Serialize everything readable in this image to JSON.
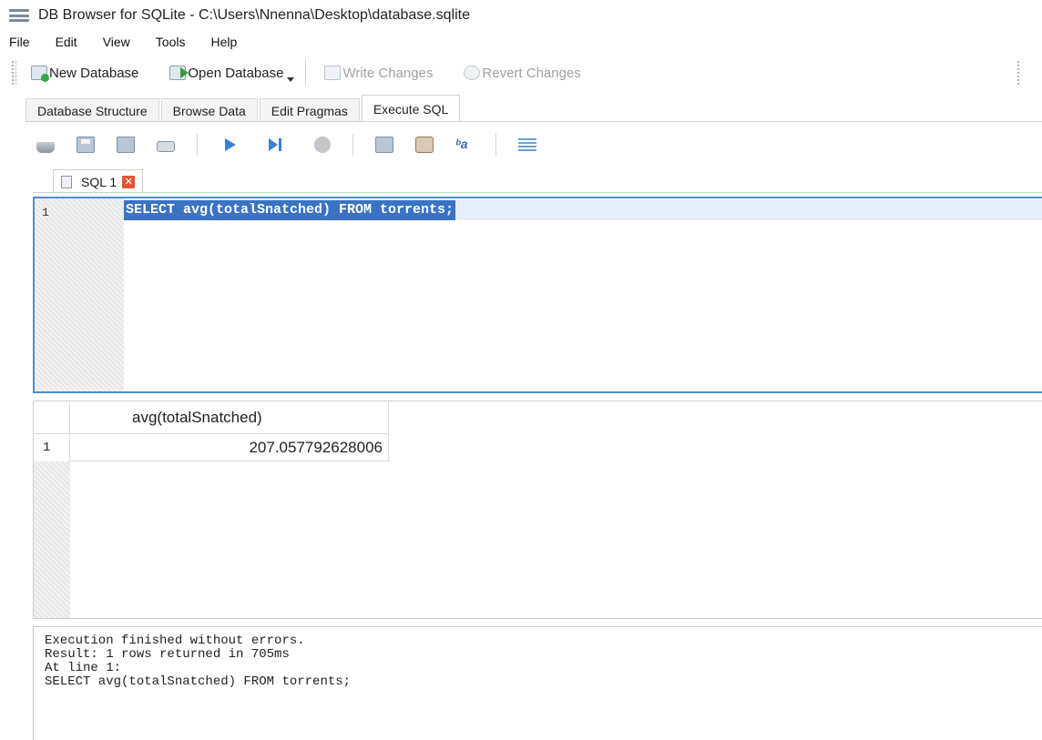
{
  "window": {
    "title": "DB Browser for SQLite - C:\\Users\\Nnenna\\Desktop\\database.sqlite"
  },
  "menu": [
    "File",
    "Edit",
    "View",
    "Tools",
    "Help"
  ],
  "toolbar": {
    "new_database": "New Database",
    "open_database": "Open Database",
    "write_changes": "Write Changes",
    "revert_changes": "Revert Changes"
  },
  "tabs": [
    {
      "label": "Database Structure",
      "active": false
    },
    {
      "label": "Browse Data",
      "active": false
    },
    {
      "label": "Edit Pragmas",
      "active": false
    },
    {
      "label": "Execute SQL",
      "active": true
    }
  ],
  "sql_toolbar_icons": [
    "open-tab-icon",
    "open-sql-file-icon",
    "save-sql-file-icon",
    "save-sql-as-icon",
    "print-icon",
    "execute-all-icon",
    "execute-line-icon",
    "stop-icon",
    "save-results-icon",
    "find-icon",
    "find-replace-icon",
    "comment-icon"
  ],
  "sql_tab": {
    "label": "SQL 1",
    "close_glyph": "✕"
  },
  "editor": {
    "lines": [
      {
        "number": "1",
        "text": "SELECT avg(totalSnatched) FROM torrents;"
      }
    ]
  },
  "results": {
    "columns": [
      "avg(totalSnatched)"
    ],
    "rows": [
      {
        "row_number": "1",
        "cells": [
          "207.057792628006"
        ]
      }
    ]
  },
  "messages": [
    "Execution finished without errors.",
    "Result: 1 rows returned in 705ms",
    "At line 1:",
    "SELECT avg(totalSnatched) FROM torrents;"
  ],
  "colors": {
    "selection": "#3a73c4",
    "editor_border": "#4d8fcf",
    "close_button": "#e3563a"
  }
}
